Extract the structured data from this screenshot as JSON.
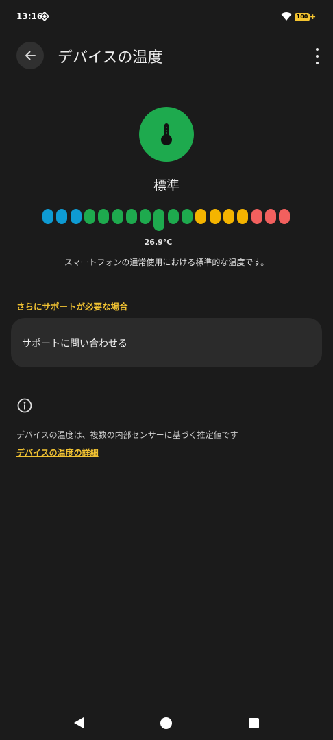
{
  "status_bar": {
    "time": "13:16",
    "battery": "100"
  },
  "header": {
    "title": "デバイスの温度"
  },
  "temperature": {
    "status_label": "標準",
    "value": "26.9°C",
    "description": "スマートフォンの通常使用における標準的な温度です。",
    "scale_colors": [
      "#0e9bd3",
      "#0e9bd3",
      "#0e9bd3",
      "#1eaa4e",
      "#1eaa4e",
      "#1eaa4e",
      "#1eaa4e",
      "#1eaa4e",
      "#1eaa4e",
      "#1eaa4e",
      "#1eaa4e",
      "#f4b400",
      "#f4b400",
      "#f4b400",
      "#f4b400",
      "#f2605e",
      "#f2605e",
      "#f2605e"
    ],
    "active_index": 8
  },
  "support": {
    "header": "さらにサポートが必要な場合",
    "contact_label": "サポートに問い合わせる"
  },
  "info": {
    "footnote": "デバイスの温度は、複数の内部センサーに基づく推定値です",
    "link": "デバイスの温度の詳細"
  },
  "icons": {
    "back": "arrow-left-icon",
    "more": "more-vert-icon",
    "thermometer": "thermometer-icon",
    "info": "info-icon"
  }
}
